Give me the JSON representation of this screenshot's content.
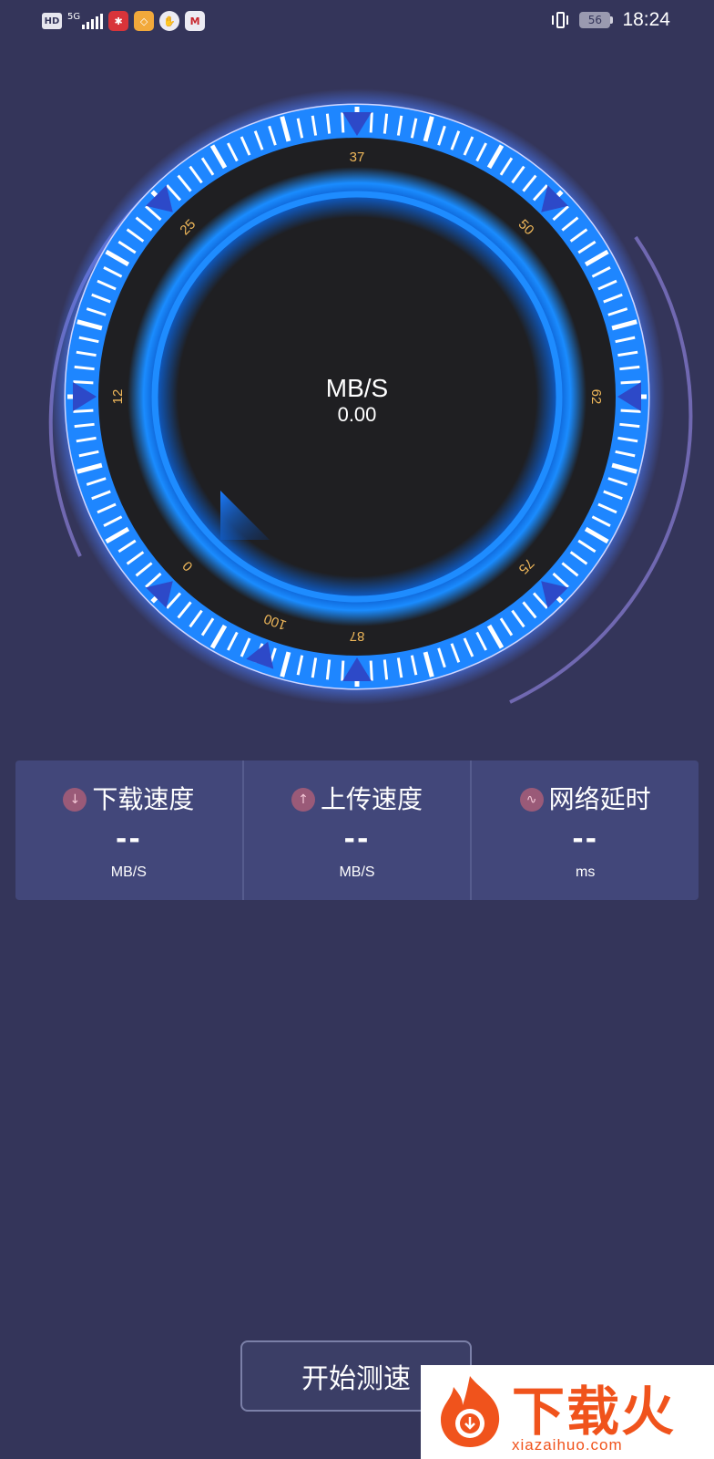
{
  "status_bar": {
    "hd": "HD",
    "network": "5G",
    "battery": "56",
    "time": "18:24",
    "icons": [
      "hd-badge",
      "signal-icon",
      "app-notification-icon",
      "shield-icon",
      "hand-icon",
      "bank-logo-icon",
      "vibrate-icon",
      "battery-icon"
    ]
  },
  "gauge": {
    "unit": "MB/S",
    "value": "0.00",
    "scale_labels": [
      "0",
      "12",
      "25",
      "37",
      "50",
      "62",
      "75",
      "87",
      "100"
    ],
    "accent_color": "#1e86ff",
    "label_color": "#f0b85a"
  },
  "stats": [
    {
      "icon": "download-arrow-icon",
      "glyph": "↓",
      "title": "下载速度",
      "value": "--",
      "unit": "MB/S"
    },
    {
      "icon": "upload-arrow-icon",
      "glyph": "↑",
      "title": "上传速度",
      "value": "--",
      "unit": "MB/S"
    },
    {
      "icon": "wave-icon",
      "glyph": "∿",
      "title": "网络延时",
      "value": "--",
      "unit": "ms"
    }
  ],
  "start_button": {
    "label": "开始测速"
  },
  "watermark": {
    "text": "下载火",
    "url": "xiazaihuo.com"
  }
}
